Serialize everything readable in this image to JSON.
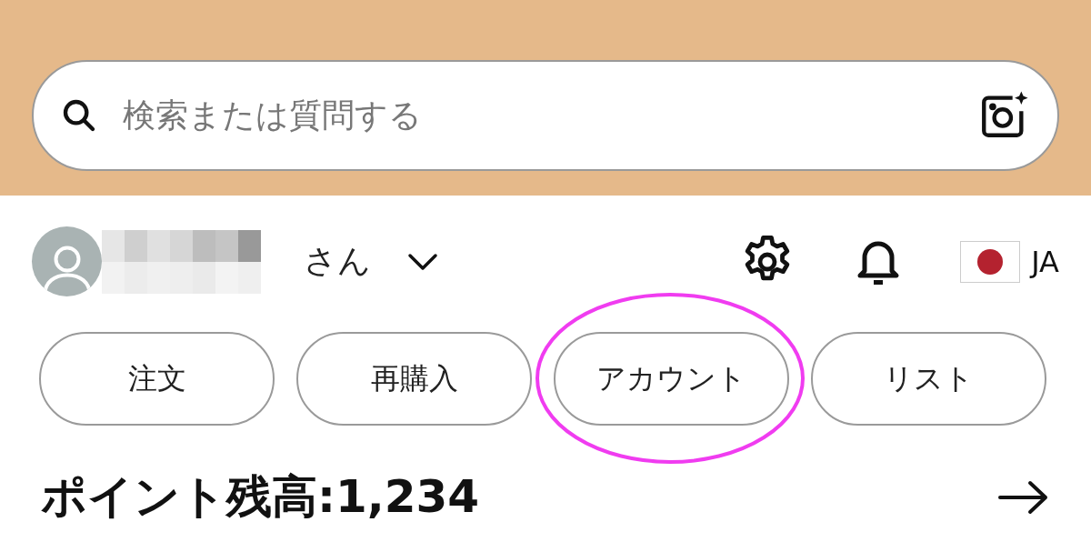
{
  "search": {
    "placeholder": "検索または質問する"
  },
  "user": {
    "suffix": "さん",
    "language": "JA"
  },
  "nav_buttons": [
    {
      "label": "注文",
      "circled": false
    },
    {
      "label": "再購入",
      "circled": false
    },
    {
      "label": "アカウント",
      "circled": true
    },
    {
      "label": "リスト",
      "circled": false
    }
  ],
  "points": {
    "label": "ポイント残高:1,234"
  }
}
